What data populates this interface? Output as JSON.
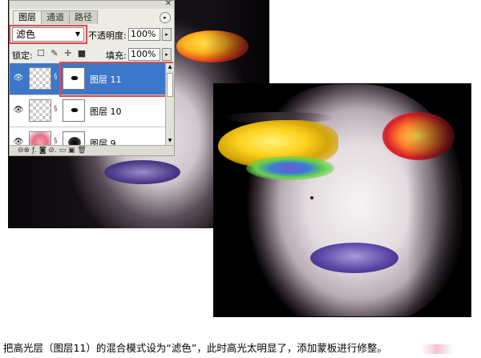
{
  "panel": {
    "close_glyph": "✕",
    "menu_glyph": "▸",
    "tabs": [
      {
        "label": "图层",
        "active": true
      },
      {
        "label": "通道",
        "active": false
      },
      {
        "label": "路径",
        "active": false
      }
    ],
    "blend_mode": "滤色",
    "blend_arrow": "▼",
    "opacity_label": "不透明度:",
    "opacity_value": "100%",
    "lock_label": "锁定:",
    "lock_icons": "☐ ✎ ✛ ■",
    "fill_label": "填充:",
    "fill_value": "100%",
    "stepper_glyph": "▸",
    "layers": [
      {
        "name": "图层 11",
        "selected": true
      },
      {
        "name": "图层 10",
        "selected": false
      },
      {
        "name": "图层 9",
        "selected": false
      }
    ],
    "bottom_icons": "⊖⊗  ƒ.  ◙  ⊘.  ▭  ▣  🗑",
    "eye_glyph": "👁",
    "chain_glyph": "§"
  },
  "caption": "把高光层（图层11）的混合模式设为“滤色”，此时高光太明显了，添加蒙板进行修整。",
  "accent": "#3d77c9",
  "highlight_color": "#e0484e"
}
